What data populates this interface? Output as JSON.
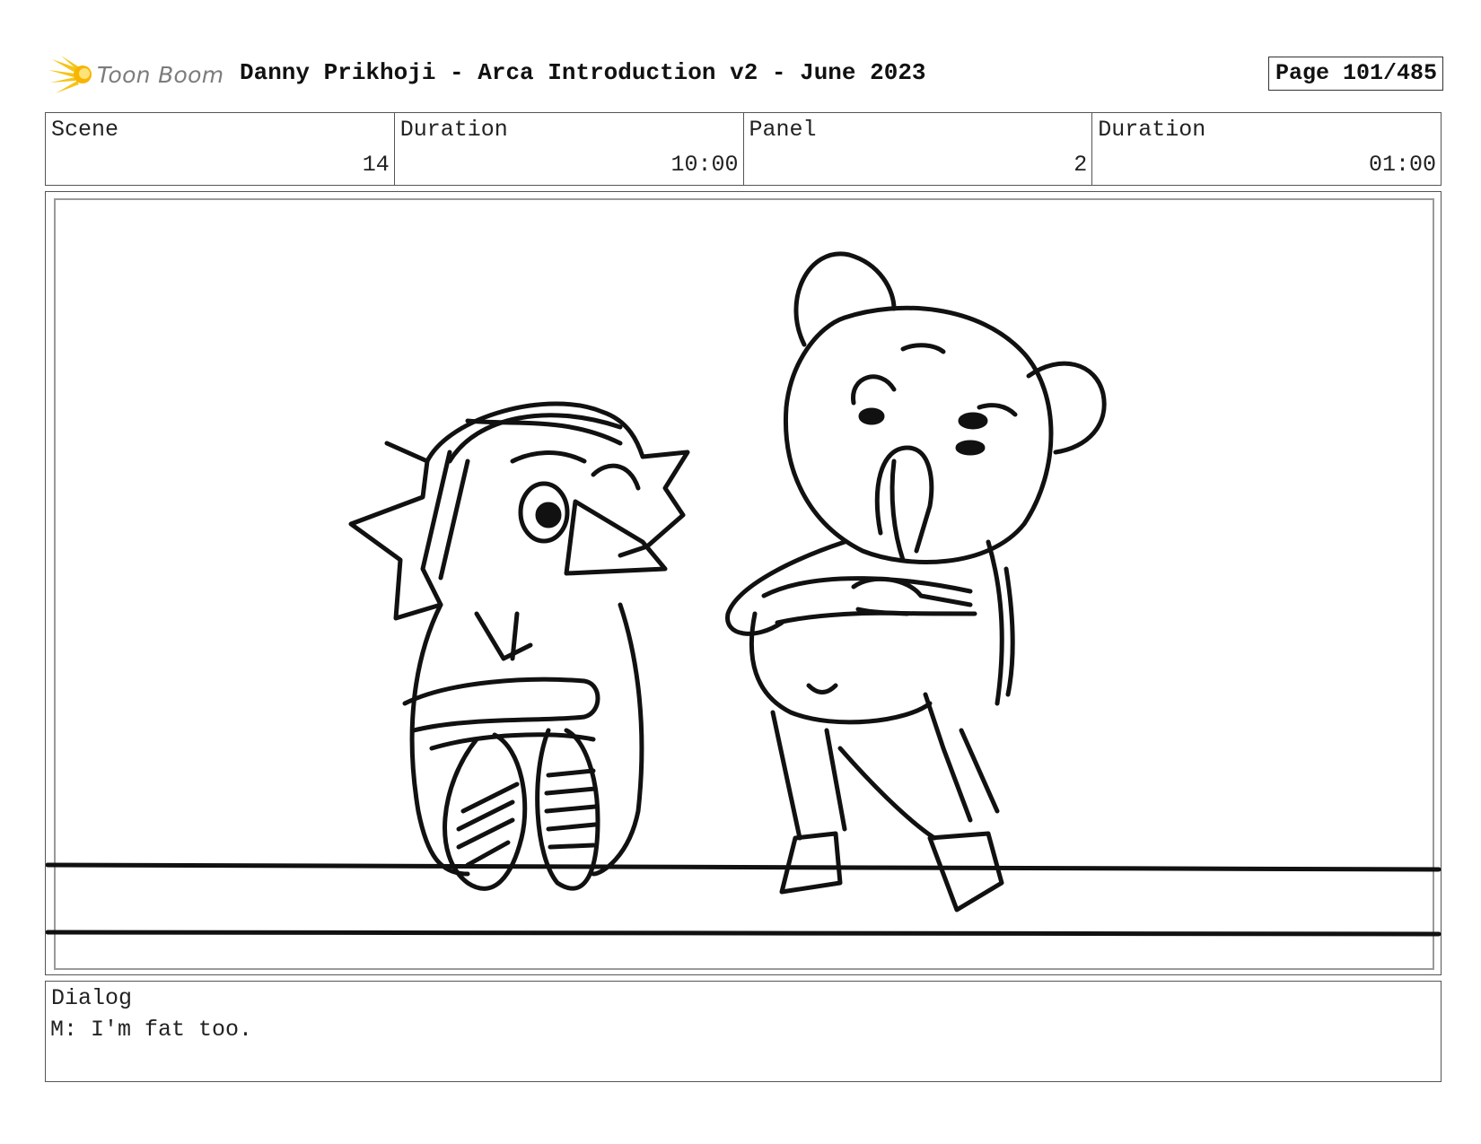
{
  "header": {
    "logo_text": "Toon Boom",
    "title": "Danny Prikhoji - Arca Introduction v2 - June 2023",
    "page_label": "Page 101/485"
  },
  "info": {
    "scene_label": "Scene",
    "scene_value": "14",
    "scene_duration_label": "Duration",
    "scene_duration_value": "10:00",
    "panel_label": "Panel",
    "panel_value": "2",
    "panel_duration_label": "Duration",
    "panel_duration_value": "01:00"
  },
  "dialog": {
    "label": "Dialog",
    "text": "M: I'm fat too."
  },
  "colors": {
    "logo_flash": "#f5c518",
    "ink": "#111111"
  }
}
